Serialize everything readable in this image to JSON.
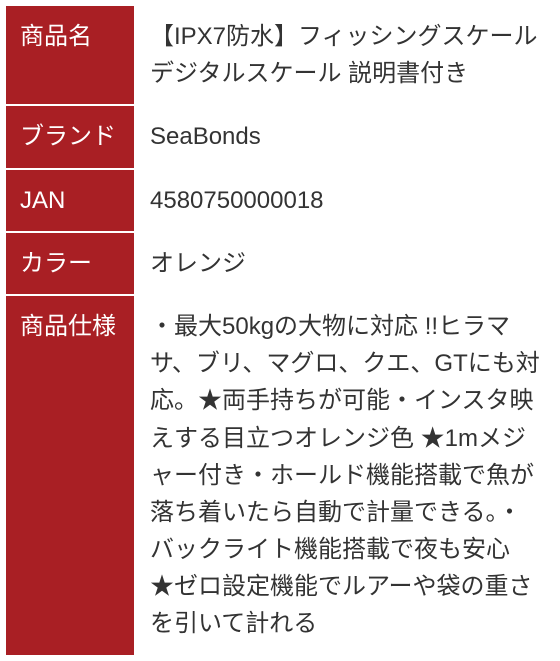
{
  "rows": [
    {
      "label": "商品名",
      "value": "【IPX7防水】フィッシングスケール デジタルスケール  説明書付き"
    },
    {
      "label": "ブランド",
      "value": "SeaBonds"
    },
    {
      "label": "JAN",
      "value": "4580750000018"
    },
    {
      "label": "カラー",
      "value": "オレンジ"
    },
    {
      "label": "商品仕様",
      "value": "・最大50kgの大物に対応 !!ヒラマサ、ブリ、マグロ、クエ、GTにも対応。★両手持ちが可能・インスタ映えする目立つオレンジ色 ★1mメジャー付き・ホールド機能搭載で魚が落ち着いたら自動で計量できる。・バックライト機能搭載で夜も安心 ★ゼロ設定機能でルアーや袋の重さを引いて計れる"
    }
  ]
}
